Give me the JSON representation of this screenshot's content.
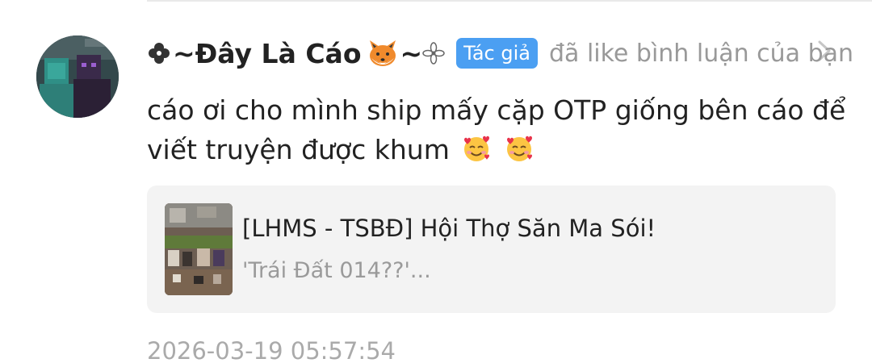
{
  "notification": {
    "username": "~Đây Là Cáo",
    "username_suffix": "~",
    "author_badge": "Tác giả",
    "action": "đã like bình luận của bạn",
    "comment_text": "cáo ơi cho mình ship mấy cặp OTP giống bên cáo để viết truyện được khum",
    "timestamp": "2026-03-19 05:57:54"
  },
  "card": {
    "title": "[LHMS - TSBĐ] Hội Thợ Săn Ma Sói!",
    "subtitle": "'Trái Đất 014??'..."
  },
  "icons": {
    "username_prefix": "clover-icon",
    "fox": "fox-face-icon",
    "username_end": "flower-icon",
    "comment_emoji": "smiling-face-with-hearts-icon",
    "nav": "chevron-right-icon"
  },
  "colors": {
    "author_badge_bg": "#4b9ff2",
    "secondary_text": "#999999",
    "card_bg": "#f3f3f3"
  }
}
